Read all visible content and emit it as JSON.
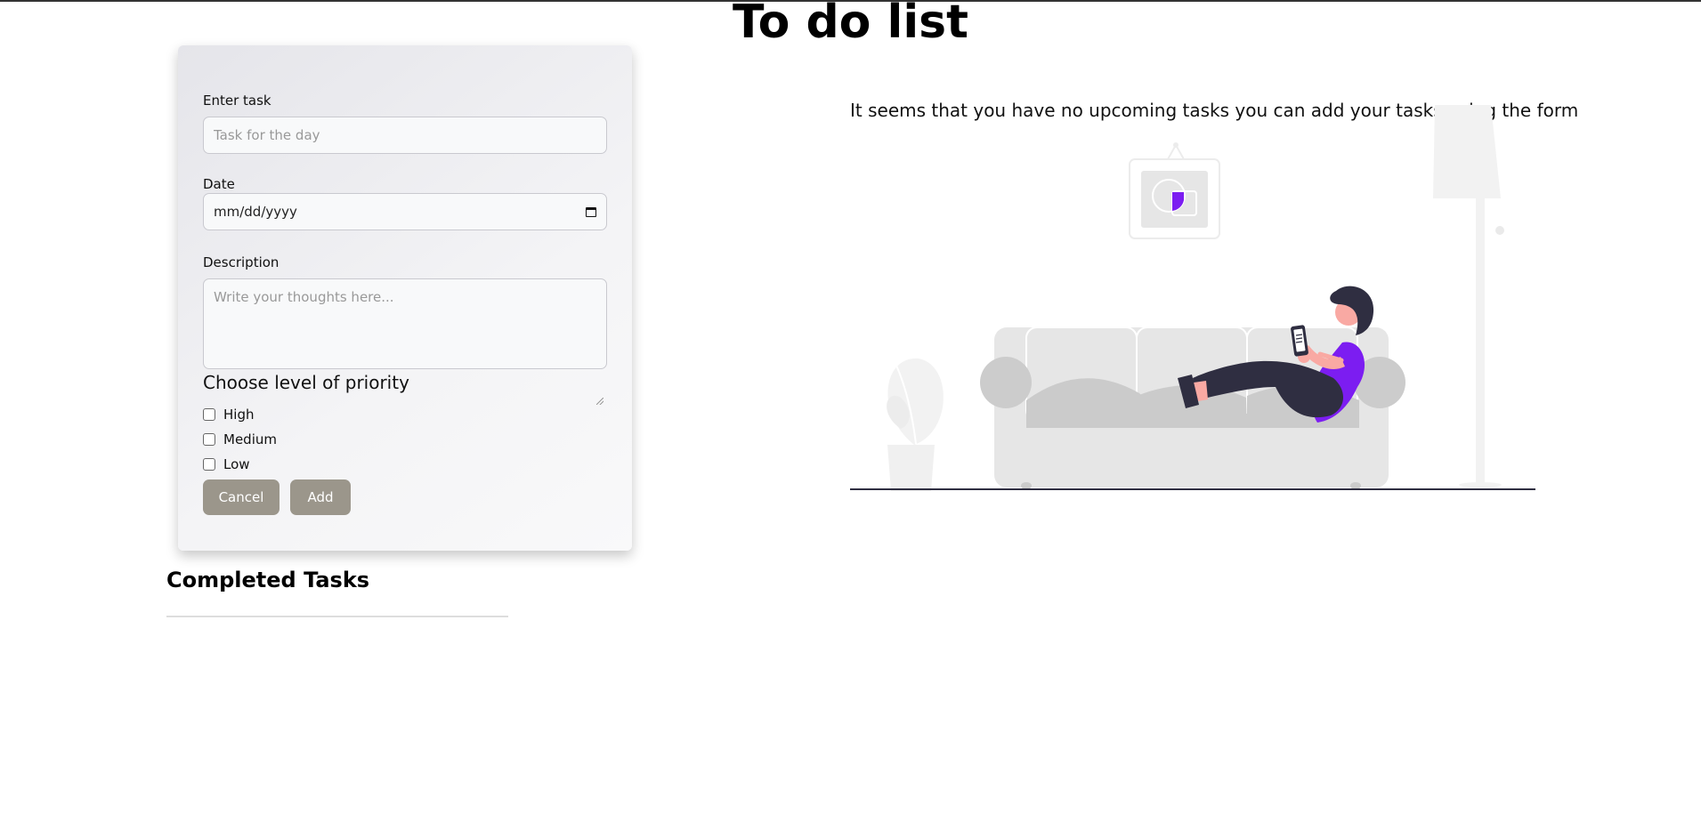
{
  "header": {
    "title": "To do list"
  },
  "form": {
    "task": {
      "label": "Enter task",
      "placeholder": "Task for the day"
    },
    "date": {
      "label": "Date",
      "placeholder": "mm/dd/yyyy"
    },
    "description": {
      "label": "Description",
      "placeholder": "Write your thoughts here..."
    },
    "priority": {
      "heading": "Choose level of priority",
      "options": [
        {
          "label": "High",
          "checked": false
        },
        {
          "label": "Medium",
          "checked": false
        },
        {
          "label": "Low",
          "checked": false
        }
      ]
    },
    "buttons": {
      "cancel": "Cancel",
      "add": "Add"
    }
  },
  "completed": {
    "heading": "Completed Tasks"
  },
  "empty_state": {
    "message": "It seems that you have no upcoming tasks you can add your tasks using the form"
  },
  "colors": {
    "accent": "#7c1df1",
    "button": "#9b968b",
    "skin": "#f9a9a3",
    "dark": "#2f2e41"
  }
}
